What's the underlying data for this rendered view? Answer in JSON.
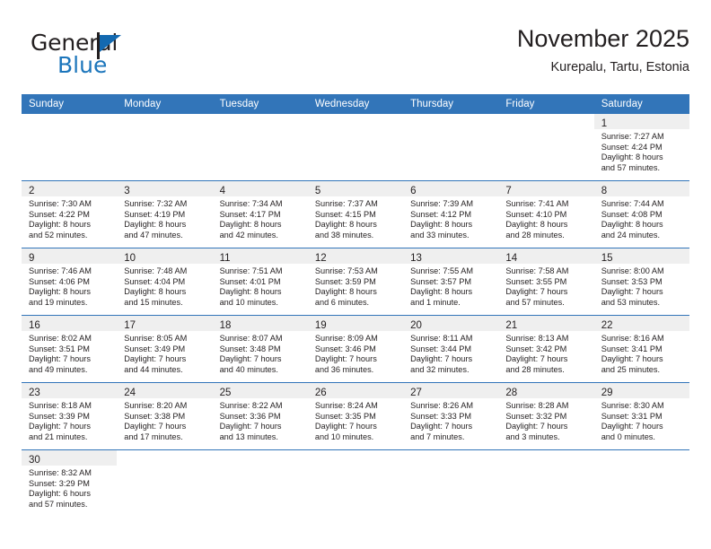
{
  "brand": {
    "name_part1": "General",
    "name_part2": "Blue",
    "accent_color": "#1b75bb",
    "flag_color": "#1369b0"
  },
  "header": {
    "title": "November 2025",
    "subtitle": "Kurepalu, Tartu, Estonia"
  },
  "theme": {
    "header_row_bg": "#3275b9",
    "daynum_band_bg": "#efefef",
    "grid_line": "#3275b9",
    "text": "#231f20"
  },
  "weekday_headers": [
    "Sunday",
    "Monday",
    "Tuesday",
    "Wednesday",
    "Thursday",
    "Friday",
    "Saturday"
  ],
  "weeks": [
    [
      {
        "empty": true
      },
      {
        "empty": true
      },
      {
        "empty": true
      },
      {
        "empty": true
      },
      {
        "empty": true
      },
      {
        "empty": true
      },
      {
        "day": "1",
        "sunrise": "Sunrise: 7:27 AM",
        "sunset": "Sunset: 4:24 PM",
        "daylight1": "Daylight: 8 hours",
        "daylight2": "and 57 minutes."
      }
    ],
    [
      {
        "day": "2",
        "sunrise": "Sunrise: 7:30 AM",
        "sunset": "Sunset: 4:22 PM",
        "daylight1": "Daylight: 8 hours",
        "daylight2": "and 52 minutes."
      },
      {
        "day": "3",
        "sunrise": "Sunrise: 7:32 AM",
        "sunset": "Sunset: 4:19 PM",
        "daylight1": "Daylight: 8 hours",
        "daylight2": "and 47 minutes."
      },
      {
        "day": "4",
        "sunrise": "Sunrise: 7:34 AM",
        "sunset": "Sunset: 4:17 PM",
        "daylight1": "Daylight: 8 hours",
        "daylight2": "and 42 minutes."
      },
      {
        "day": "5",
        "sunrise": "Sunrise: 7:37 AM",
        "sunset": "Sunset: 4:15 PM",
        "daylight1": "Daylight: 8 hours",
        "daylight2": "and 38 minutes."
      },
      {
        "day": "6",
        "sunrise": "Sunrise: 7:39 AM",
        "sunset": "Sunset: 4:12 PM",
        "daylight1": "Daylight: 8 hours",
        "daylight2": "and 33 minutes."
      },
      {
        "day": "7",
        "sunrise": "Sunrise: 7:41 AM",
        "sunset": "Sunset: 4:10 PM",
        "daylight1": "Daylight: 8 hours",
        "daylight2": "and 28 minutes."
      },
      {
        "day": "8",
        "sunrise": "Sunrise: 7:44 AM",
        "sunset": "Sunset: 4:08 PM",
        "daylight1": "Daylight: 8 hours",
        "daylight2": "and 24 minutes."
      }
    ],
    [
      {
        "day": "9",
        "sunrise": "Sunrise: 7:46 AM",
        "sunset": "Sunset: 4:06 PM",
        "daylight1": "Daylight: 8 hours",
        "daylight2": "and 19 minutes."
      },
      {
        "day": "10",
        "sunrise": "Sunrise: 7:48 AM",
        "sunset": "Sunset: 4:04 PM",
        "daylight1": "Daylight: 8 hours",
        "daylight2": "and 15 minutes."
      },
      {
        "day": "11",
        "sunrise": "Sunrise: 7:51 AM",
        "sunset": "Sunset: 4:01 PM",
        "daylight1": "Daylight: 8 hours",
        "daylight2": "and 10 minutes."
      },
      {
        "day": "12",
        "sunrise": "Sunrise: 7:53 AM",
        "sunset": "Sunset: 3:59 PM",
        "daylight1": "Daylight: 8 hours",
        "daylight2": "and 6 minutes."
      },
      {
        "day": "13",
        "sunrise": "Sunrise: 7:55 AM",
        "sunset": "Sunset: 3:57 PM",
        "daylight1": "Daylight: 8 hours",
        "daylight2": "and 1 minute."
      },
      {
        "day": "14",
        "sunrise": "Sunrise: 7:58 AM",
        "sunset": "Sunset: 3:55 PM",
        "daylight1": "Daylight: 7 hours",
        "daylight2": "and 57 minutes."
      },
      {
        "day": "15",
        "sunrise": "Sunrise: 8:00 AM",
        "sunset": "Sunset: 3:53 PM",
        "daylight1": "Daylight: 7 hours",
        "daylight2": "and 53 minutes."
      }
    ],
    [
      {
        "day": "16",
        "sunrise": "Sunrise: 8:02 AM",
        "sunset": "Sunset: 3:51 PM",
        "daylight1": "Daylight: 7 hours",
        "daylight2": "and 49 minutes."
      },
      {
        "day": "17",
        "sunrise": "Sunrise: 8:05 AM",
        "sunset": "Sunset: 3:49 PM",
        "daylight1": "Daylight: 7 hours",
        "daylight2": "and 44 minutes."
      },
      {
        "day": "18",
        "sunrise": "Sunrise: 8:07 AM",
        "sunset": "Sunset: 3:48 PM",
        "daylight1": "Daylight: 7 hours",
        "daylight2": "and 40 minutes."
      },
      {
        "day": "19",
        "sunrise": "Sunrise: 8:09 AM",
        "sunset": "Sunset: 3:46 PM",
        "daylight1": "Daylight: 7 hours",
        "daylight2": "and 36 minutes."
      },
      {
        "day": "20",
        "sunrise": "Sunrise: 8:11 AM",
        "sunset": "Sunset: 3:44 PM",
        "daylight1": "Daylight: 7 hours",
        "daylight2": "and 32 minutes."
      },
      {
        "day": "21",
        "sunrise": "Sunrise: 8:13 AM",
        "sunset": "Sunset: 3:42 PM",
        "daylight1": "Daylight: 7 hours",
        "daylight2": "and 28 minutes."
      },
      {
        "day": "22",
        "sunrise": "Sunrise: 8:16 AM",
        "sunset": "Sunset: 3:41 PM",
        "daylight1": "Daylight: 7 hours",
        "daylight2": "and 25 minutes."
      }
    ],
    [
      {
        "day": "23",
        "sunrise": "Sunrise: 8:18 AM",
        "sunset": "Sunset: 3:39 PM",
        "daylight1": "Daylight: 7 hours",
        "daylight2": "and 21 minutes."
      },
      {
        "day": "24",
        "sunrise": "Sunrise: 8:20 AM",
        "sunset": "Sunset: 3:38 PM",
        "daylight1": "Daylight: 7 hours",
        "daylight2": "and 17 minutes."
      },
      {
        "day": "25",
        "sunrise": "Sunrise: 8:22 AM",
        "sunset": "Sunset: 3:36 PM",
        "daylight1": "Daylight: 7 hours",
        "daylight2": "and 13 minutes."
      },
      {
        "day": "26",
        "sunrise": "Sunrise: 8:24 AM",
        "sunset": "Sunset: 3:35 PM",
        "daylight1": "Daylight: 7 hours",
        "daylight2": "and 10 minutes."
      },
      {
        "day": "27",
        "sunrise": "Sunrise: 8:26 AM",
        "sunset": "Sunset: 3:33 PM",
        "daylight1": "Daylight: 7 hours",
        "daylight2": "and 7 minutes."
      },
      {
        "day": "28",
        "sunrise": "Sunrise: 8:28 AM",
        "sunset": "Sunset: 3:32 PM",
        "daylight1": "Daylight: 7 hours",
        "daylight2": "and 3 minutes."
      },
      {
        "day": "29",
        "sunrise": "Sunrise: 8:30 AM",
        "sunset": "Sunset: 3:31 PM",
        "daylight1": "Daylight: 7 hours",
        "daylight2": "and 0 minutes."
      }
    ],
    [
      {
        "day": "30",
        "sunrise": "Sunrise: 8:32 AM",
        "sunset": "Sunset: 3:29 PM",
        "daylight1": "Daylight: 6 hours",
        "daylight2": "and 57 minutes."
      },
      {
        "empty": true
      },
      {
        "empty": true
      },
      {
        "empty": true
      },
      {
        "empty": true
      },
      {
        "empty": true
      },
      {
        "empty": true
      }
    ]
  ]
}
